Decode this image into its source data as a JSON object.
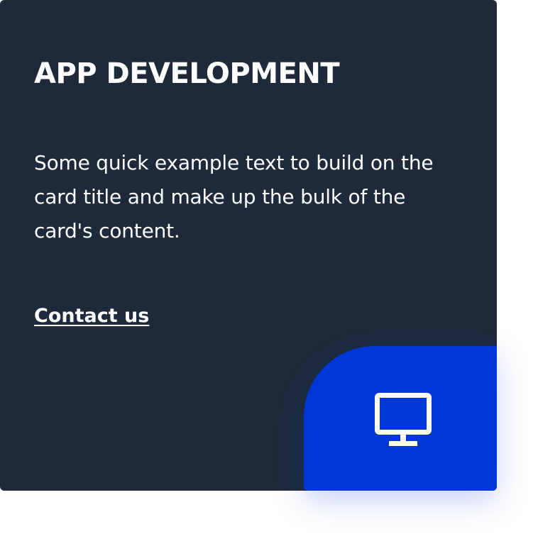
{
  "card": {
    "title": "APP DEVELOPMENT",
    "text": "Some quick example text to build on the card title and make up the bulk of the card's content.",
    "link_label": "Contact us",
    "icon": "monitor-icon",
    "colors": {
      "background": "#1e2a3a",
      "accent": "#0037d6",
      "text": "#ffffff"
    }
  }
}
